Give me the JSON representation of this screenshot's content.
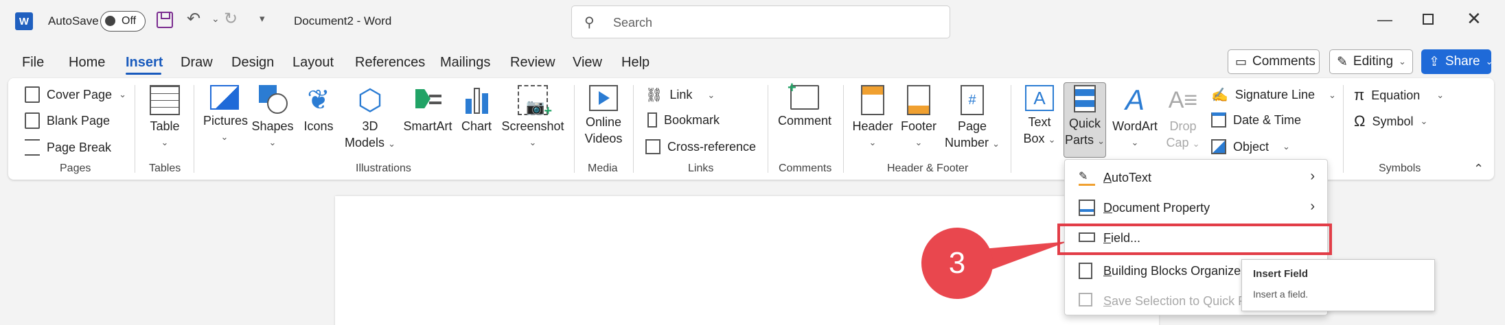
{
  "titlebar": {
    "autosave_label": "AutoSave",
    "autosave_state": "Off",
    "doc_title": "Document2  -  Word",
    "search_placeholder": "Search",
    "logo_letter": "W"
  },
  "tabs": [
    "File",
    "Home",
    "Insert",
    "Draw",
    "Design",
    "Layout",
    "References",
    "Mailings",
    "Review",
    "View",
    "Help"
  ],
  "active_tab": "Insert",
  "top_buttons": {
    "comments": "Comments",
    "editing": "Editing",
    "share": "Share"
  },
  "ribbon": {
    "pages": {
      "label": "Pages",
      "cover_page": "Cover Page",
      "blank_page": "Blank Page",
      "page_break": "Page Break"
    },
    "tables": {
      "label": "Tables",
      "table": "Table"
    },
    "illustrations": {
      "label": "Illustrations",
      "pictures": "Pictures",
      "shapes": "Shapes",
      "icons": "Icons",
      "models_1": "3D",
      "models_2": "Models",
      "smartart": "SmartArt",
      "chart": "Chart",
      "screenshot": "Screenshot"
    },
    "media": {
      "label": "Media",
      "online_1": "Online",
      "online_2": "Videos"
    },
    "links": {
      "label": "Links",
      "link": "Link",
      "bookmark": "Bookmark",
      "cross_reference": "Cross-reference"
    },
    "comments": {
      "label": "Comments",
      "comment": "Comment"
    },
    "header_footer": {
      "label": "Header & Footer",
      "header": "Header",
      "footer": "Footer",
      "page_number_1": "Page",
      "page_number_2": "Number"
    },
    "text": {
      "text_box_1": "Text",
      "text_box_2": "Box",
      "quick_parts_1": "Quick",
      "quick_parts_2": "Parts",
      "wordart": "WordArt",
      "drop_cap_1": "Drop",
      "drop_cap_2": "Cap",
      "signature_line": "Signature Line",
      "date_time": "Date & Time",
      "object": "Object"
    },
    "symbols": {
      "label": "Symbols",
      "equation": "Equation",
      "symbol": "Symbol"
    }
  },
  "menu": {
    "items": [
      {
        "label": "AutoText",
        "accel": "A",
        "rest": "utoText",
        "submenu": true
      },
      {
        "label": "Document Property",
        "accel": "D",
        "rest": "ocument Property",
        "submenu": true
      },
      {
        "label": "Field...",
        "accel": "F",
        "rest": "ield...",
        "submenu": false
      },
      {
        "label": "Building Blocks Organizer...",
        "accel": "B",
        "rest": "uilding Blocks Organizer",
        "submenu": false
      },
      {
        "label": "Save Selection to Quick Part Gallery...",
        "accel": "S",
        "rest": "ave Selection to Quick P",
        "submenu": false
      }
    ]
  },
  "tooltip": {
    "title": "Insert Field",
    "description": "Insert a field."
  },
  "callout": {
    "step": "3"
  },
  "colors": {
    "accent": "#185abd",
    "highlight": "#e23d47",
    "callout": "#e9474e"
  }
}
